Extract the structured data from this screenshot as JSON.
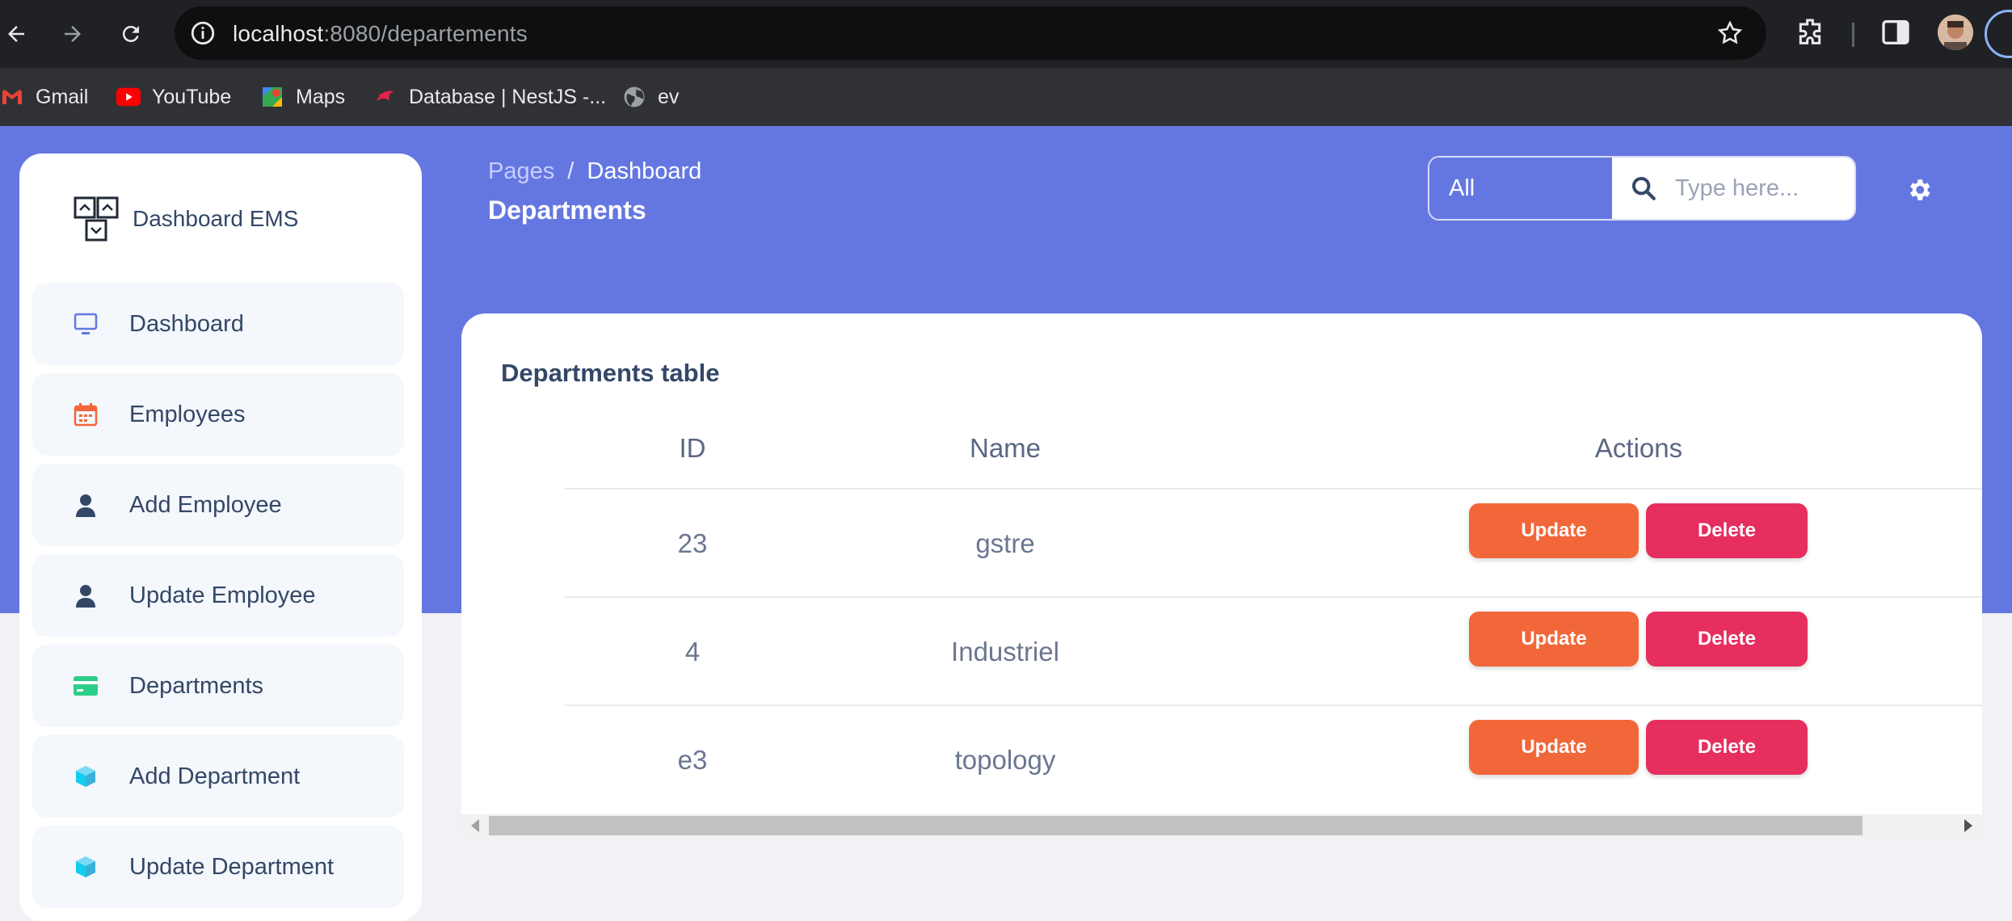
{
  "browser": {
    "url_host": "localhost",
    "url_path": ":8080/departements"
  },
  "bookmarks": [
    {
      "label": "Gmail",
      "icon": "gmail-icon"
    },
    {
      "label": "YouTube",
      "icon": "youtube-icon"
    },
    {
      "label": "Maps",
      "icon": "maps-icon"
    },
    {
      "label": "Database | NestJS -...",
      "icon": "nestjs-icon"
    },
    {
      "label": "ev",
      "icon": "globe-icon"
    }
  ],
  "sidebar": {
    "brand": "Dashboard EMS",
    "items": [
      {
        "label": "Dashboard",
        "icon": "monitor-icon"
      },
      {
        "label": "Employees",
        "icon": "calendar-icon"
      },
      {
        "label": "Add Employee",
        "icon": "user-icon"
      },
      {
        "label": "Update Employee",
        "icon": "user-icon"
      },
      {
        "label": "Departments",
        "icon": "credit-card-icon"
      },
      {
        "label": "Add Department",
        "icon": "box-icon"
      },
      {
        "label": "Update Department",
        "icon": "box-icon"
      }
    ]
  },
  "header": {
    "breadcrumb_parent": "Pages",
    "breadcrumb_sep": "/",
    "breadcrumb_current": "Dashboard",
    "title": "Departments",
    "search_scope": "All",
    "search_placeholder": "Type here..."
  },
  "table": {
    "title": "Departments table",
    "columns": [
      "ID",
      "Name",
      "Actions"
    ],
    "rows": [
      {
        "id": "23",
        "name": "gstre"
      },
      {
        "id": "4",
        "name": "Industriel"
      },
      {
        "id": "e3",
        "name": "topology"
      }
    ],
    "update_label": "Update",
    "delete_label": "Delete"
  },
  "colors": {
    "hero": "#6477e1",
    "update": "#f26739",
    "delete": "#e62e5f"
  }
}
